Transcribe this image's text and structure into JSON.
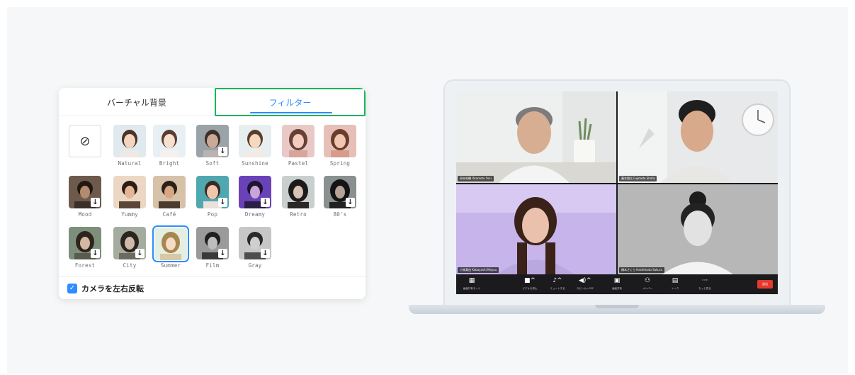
{
  "filter_panel": {
    "tabs": [
      {
        "label": "バーチャル背景"
      },
      {
        "label": "フィルター",
        "active": true
      }
    ],
    "none_symbol": "⊘",
    "filters": [
      {
        "label": "Natural",
        "download": false
      },
      {
        "label": "Bright",
        "download": false
      },
      {
        "label": "Soft",
        "download": true
      },
      {
        "label": "Sunshine",
        "download": false
      },
      {
        "label": "Pastel",
        "download": false
      },
      {
        "label": "Spring",
        "download": false
      },
      {
        "label": "Mood",
        "download": true
      },
      {
        "label": "Yummy",
        "download": false
      },
      {
        "label": "Café",
        "download": false
      },
      {
        "label": "Pop",
        "download": true
      },
      {
        "label": "Dreamy",
        "download": true
      },
      {
        "label": "Retro",
        "download": false
      },
      {
        "label": "80's",
        "download": true
      },
      {
        "label": "Forest",
        "download": true
      },
      {
        "label": "City",
        "download": true
      },
      {
        "label": "Summer",
        "download": false,
        "selected": true
      },
      {
        "label": "Film",
        "download": true
      },
      {
        "label": "Gray",
        "download": true
      }
    ],
    "download_glyph": "↓",
    "mirror_checkbox": {
      "label": "カメラを左右反転",
      "checked": true,
      "check_glyph": "✓"
    },
    "accent_color": "#2d8cff",
    "highlight_color": "#1db45a"
  },
  "meeting": {
    "participants": [
      {
        "name": "岡本裕輔 Okamoto Yuki"
      },
      {
        "name": "藤本翔太 Fujimoto Shota"
      },
      {
        "name": "小林真由 Kobayashi Mayuu"
      },
      {
        "name": "橋本さくら Hashimoto Sakura"
      }
    ],
    "controls": [
      {
        "icon": "▦",
        "label": "画面共有モード"
      },
      {
        "icon": "■^",
        "label": "ビデオを停止"
      },
      {
        "icon": "♪^",
        "label": "ミュートする"
      },
      {
        "icon": "◀)^",
        "label": "スピーカーOFF"
      },
      {
        "icon": "▣",
        "label": "画面共有"
      },
      {
        "icon": "⚇",
        "label": "メンバー"
      },
      {
        "icon": "▤",
        "label": "トーク"
      },
      {
        "icon": "···",
        "label": "もっと見る"
      }
    ],
    "end_label": "退出",
    "end_color": "#e5392d"
  }
}
